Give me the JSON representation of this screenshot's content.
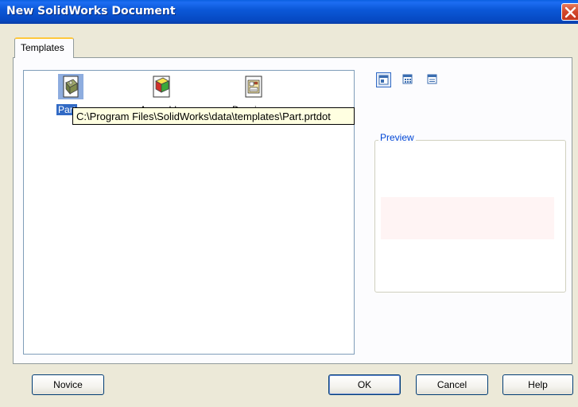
{
  "window": {
    "title": "New SolidWorks Document"
  },
  "tabs": [
    {
      "label": "Templates",
      "active": true
    }
  ],
  "templates": [
    {
      "label": "Part",
      "icon": "part-icon",
      "selected": true
    },
    {
      "label": "Assembly",
      "icon": "assembly-icon",
      "selected": false
    },
    {
      "label": "Drawing",
      "icon": "drawing-icon",
      "selected": false
    }
  ],
  "tooltip": {
    "text": "C:\\Program Files\\SolidWorks\\data\\templates\\Part.prtdot"
  },
  "view_buttons": [
    {
      "icon": "large-icons-view-icon",
      "active": true
    },
    {
      "icon": "list-view-icon",
      "active": false
    },
    {
      "icon": "details-view-icon",
      "active": false
    }
  ],
  "preview": {
    "legend": "Preview"
  },
  "buttons": {
    "novice": "Novice",
    "ok": "OK",
    "cancel": "Cancel",
    "help": "Help"
  },
  "colors": {
    "titlebar": "#0b58d8",
    "selection": "#316ac5",
    "tooltip_bg": "#ffffe1",
    "tab_highlight": "#ffc83c"
  }
}
